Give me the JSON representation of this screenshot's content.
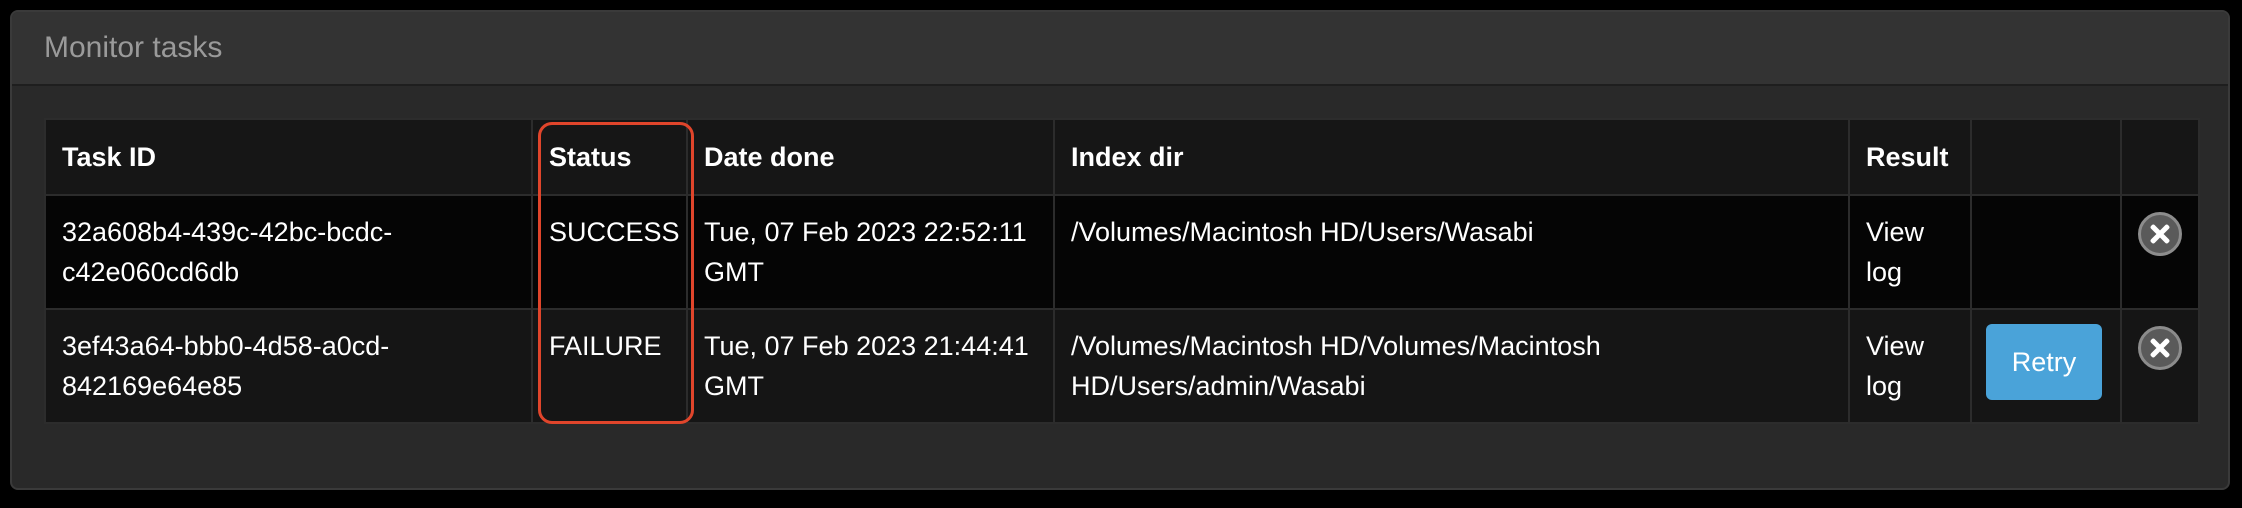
{
  "panel": {
    "title": "Monitor tasks"
  },
  "table": {
    "columns": [
      "Task ID",
      "Status",
      "Date done",
      "Index dir",
      "Result",
      "",
      ""
    ],
    "rows": [
      {
        "task_id": "32a608b4-439c-42bc-bcdc-c42e060cd6db",
        "status": "SUCCESS",
        "date_done": "Tue, 07 Feb 2023 22:52:11 GMT",
        "index_dir": "/Volumes/Macintosh HD/Users/Wasabi",
        "result": "View log",
        "action": ""
      },
      {
        "task_id": "3ef43a64-bbb0-4d58-a0cd-842169e64e85",
        "status": "FAILURE",
        "date_done": "Tue, 07 Feb 2023 21:44:41 GMT",
        "index_dir": "/Volumes/Macintosh HD/Volumes/Macintosh HD/Users/admin/Wasabi",
        "result": "View log",
        "action": "Retry"
      }
    ]
  },
  "icons": {
    "remove": "close-circle-icon"
  },
  "colors": {
    "retry_button": "#4aa3d9",
    "highlight": "#e0452b",
    "panel_header": "#333333"
  }
}
